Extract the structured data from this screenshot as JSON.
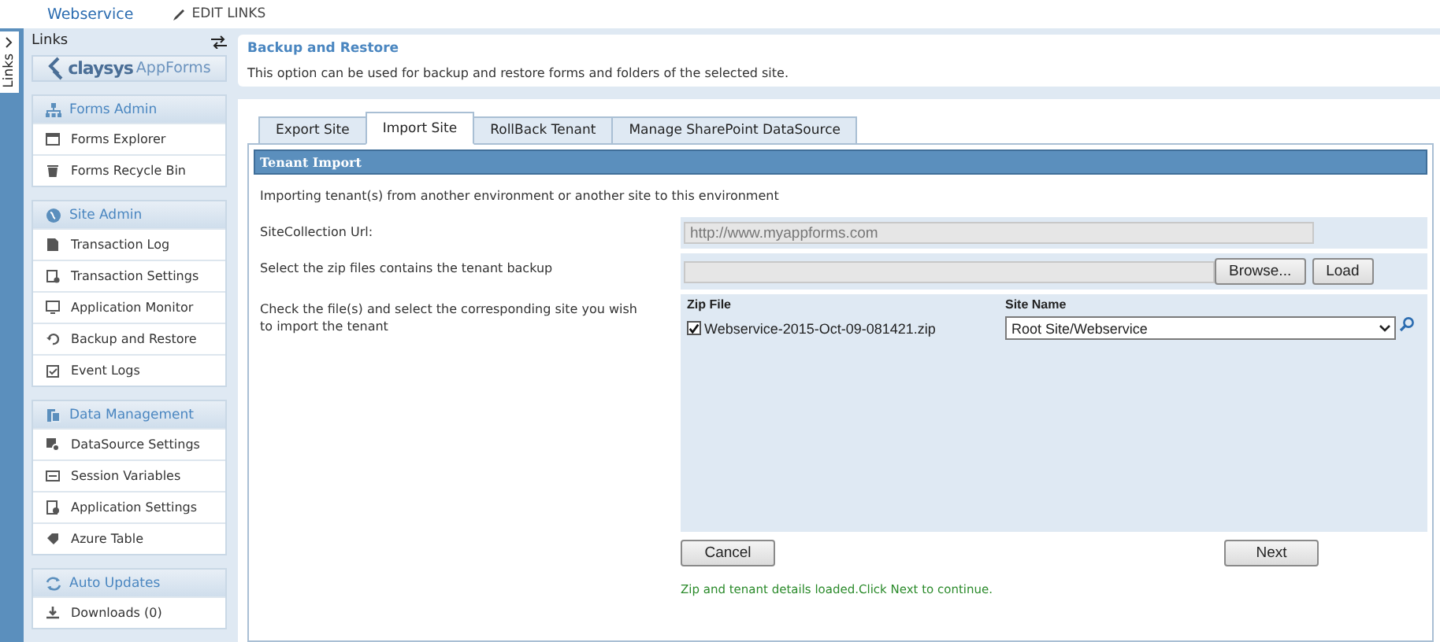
{
  "top_bar": {
    "site_link": "Webservice",
    "edit_links": "EDIT LINKS"
  },
  "side_tab": {
    "label": "Links"
  },
  "sidebar": {
    "title": "Links",
    "logo": {
      "brand": "claysys",
      "product": "AppForms"
    },
    "sections": [
      {
        "title": "Forms Admin",
        "items": [
          "Forms Explorer",
          "Forms Recycle Bin"
        ]
      },
      {
        "title": "Site Admin",
        "items": [
          "Transaction Log",
          "Transaction Settings",
          "Application Monitor",
          "Backup and Restore",
          "Event Logs"
        ]
      },
      {
        "title": "Data Management",
        "items": [
          "DataSource Settings",
          "Session Variables",
          "Application Settings",
          "Azure Table"
        ]
      },
      {
        "title": "Auto Updates",
        "items": [
          "Downloads (0)"
        ]
      }
    ]
  },
  "page": {
    "title": "Backup and Restore",
    "description": "This option can be used for backup and restore forms and folders of the selected site."
  },
  "tabs": [
    {
      "label": "Export Site",
      "selected": false
    },
    {
      "label": "Import Site",
      "selected": true
    },
    {
      "label": "RollBack Tenant",
      "selected": false
    },
    {
      "label": "Manage SharePoint DataSource",
      "selected": false
    }
  ],
  "panel": {
    "title": "Tenant Import",
    "intro": "Importing tenant(s) from another environment or another site to this environment",
    "site_url": {
      "label": "SiteCollection Url:",
      "value": "http://www.myappforms.com",
      "disabled": true
    },
    "zip_upload": {
      "label": "Select the zip files contains the tenant backup",
      "browse_button": "Browse...",
      "load_button": "Load"
    },
    "file_select": {
      "label": "Check the file(s) and select the corresponding site you wish to import the tenant",
      "columns": [
        "Zip File",
        "Site Name"
      ],
      "rows": [
        {
          "file": "Webservice-2015-Oct-09-081421.zip",
          "checked": true,
          "site": "Root Site/Webservice"
        }
      ]
    },
    "buttons": {
      "cancel": "Cancel",
      "next": "Next"
    },
    "status_message": "Zip and tenant details loaded.Click Next to continue."
  }
}
